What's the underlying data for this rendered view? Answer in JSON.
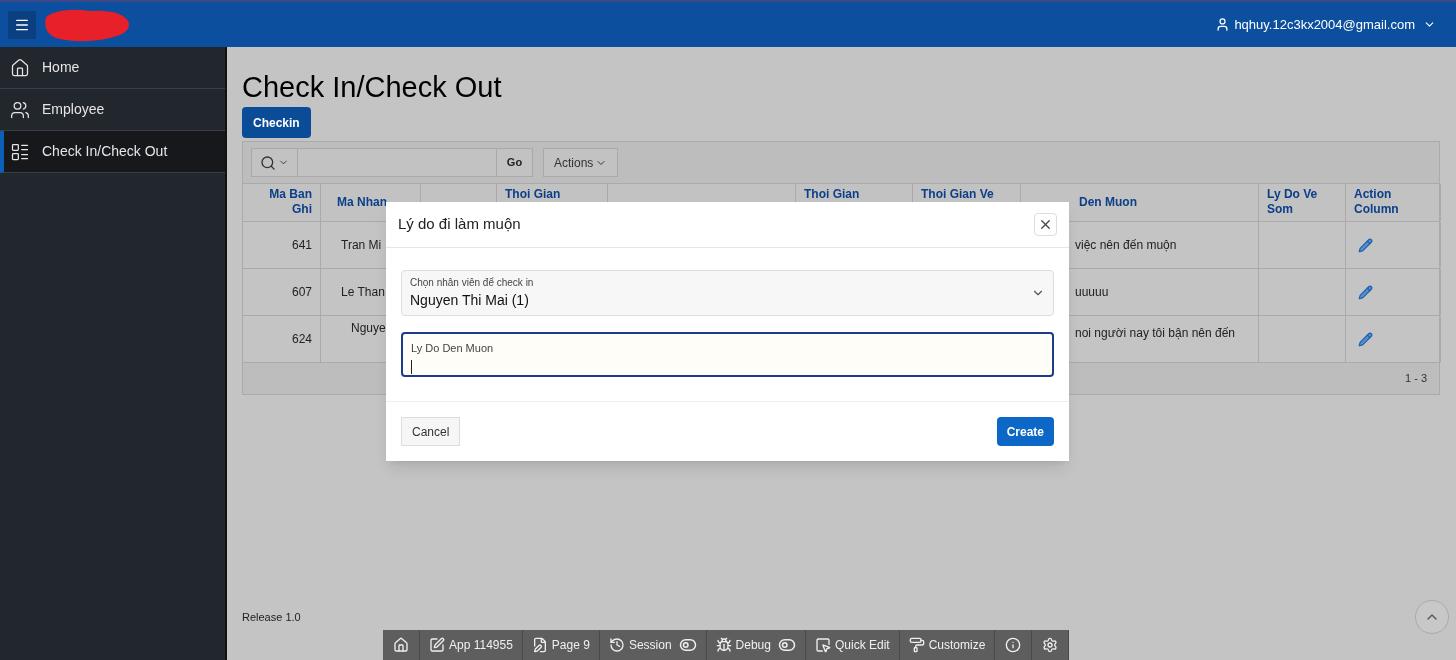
{
  "header": {
    "user": "hqhuy.12c3kx2004@gmail.com"
  },
  "sidebar": {
    "items": [
      {
        "label": "Home",
        "selected": false
      },
      {
        "label": "Employee",
        "selected": false
      },
      {
        "label": "Check In/Check Out",
        "selected": true
      }
    ]
  },
  "page": {
    "title": "Check In/Check Out",
    "primary_button": "Checkin"
  },
  "report": {
    "search_button": "Go",
    "actions_button": "Actions",
    "columns": [
      "Ma Ban Ghi",
      "Ma Nhan",
      "Thoi Gian",
      "Thoi Gian",
      "Thoi Gian Ve",
      "Den Muon",
      "Ly Do Ve Som",
      "Action Column"
    ],
    "rows": [
      {
        "id": "641",
        "employee": "Tran Mi",
        "late_reason": "việc nên đến muộn"
      },
      {
        "id": "607",
        "employee": "Le Than",
        "late_reason": "uuuuu"
      },
      {
        "id": "624",
        "employee": "Nguye",
        "late_reason": "noi người nay tôi bận nên đến"
      }
    ],
    "pagination": "1 - 3"
  },
  "dialog": {
    "title": "Lý do đi làm muộn",
    "select": {
      "label": "Chọn nhân viên để check in",
      "value": "Nguyen Thi Mai (1)"
    },
    "textarea": {
      "label": "Ly Do Den Muon",
      "focused": true
    },
    "cancel": "Cancel",
    "create": "Create"
  },
  "footer": {
    "release": "Release 1.0"
  },
  "dev_toolbar": [
    {
      "kind": "icon"
    },
    {
      "kind": "text",
      "label": "App 114955"
    },
    {
      "kind": "text",
      "label": "Page 9"
    },
    {
      "kind": "toggle",
      "label": "Session"
    },
    {
      "kind": "toggle",
      "label": "Debug"
    },
    {
      "kind": "text",
      "label": "Quick Edit"
    },
    {
      "kind": "text",
      "label": "Customize"
    },
    {
      "kind": "icon"
    },
    {
      "kind": "icon"
    }
  ]
}
